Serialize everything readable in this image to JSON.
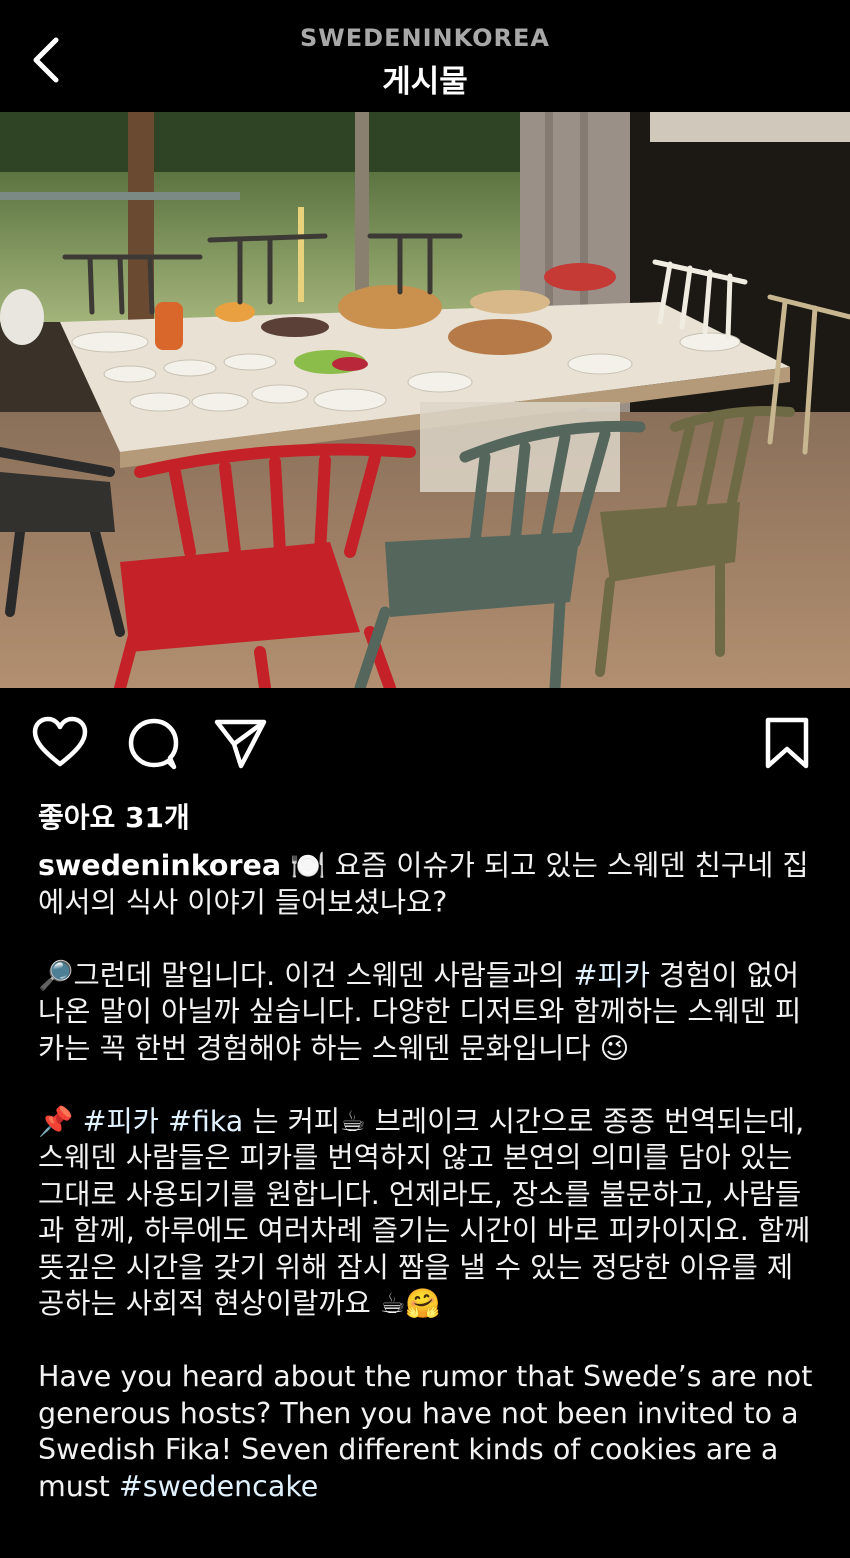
{
  "header": {
    "account": "SWEDENINKOREA",
    "title": "게시물"
  },
  "icons": {
    "back": "chevron-left-icon",
    "like": "heart-icon",
    "comment": "comment-bubble-icon",
    "share": "paper-plane-icon",
    "save": "bookmark-icon"
  },
  "post": {
    "likes_text": "좋아요 31개",
    "caption": {
      "username": "swedeninkorea",
      "p1_emoji": "🍽️",
      "p1_text": "요즘 이슈가 되고 있는 스웨덴 친구네 집에서의 식사 이야기 들어보셨나요?",
      "p2_emoji": "🔎",
      "p2_text_a": "그런데 말입니다. 이건 스웨덴 사람들과의 ",
      "p2_hashtag": "#피카",
      "p2_text_b": " 경험이 없어 나온 말이 아닐까 싶습니다. 다양한 디저트와 함께하는 스웨덴 피카는 꼭 한번 경험해야 하는 스웨덴 문화입니다 ",
      "p2_end_emoji": "😉",
      "p3_emoji": "📌",
      "p3_hashtag1": "#피카",
      "p3_hashtag2": "#fika",
      "p3_text_a": " 는 커피",
      "p3_coffee": "☕",
      "p3_text_b": " 브레이크 시간으로 종종 번역되는데, 스웨덴 사람들은 피카를 번역하지 않고 본연의 의미를 담아 있는 그대로 사용되기를 원합니다. 언제라도, 장소를 불문하고, 사람들과 함께, 하루에도 여러차례 즐기는 시간이 바로 피카이지요. 함께 뜻깊은 시간을 갖기 위해 잠시 짬을 낼 수 있는 정당한 이유를 제공하는 사회적 현상이랄까요 ",
      "p3_end_emoji1": "☕",
      "p3_end_emoji2": "🤗",
      "p4_text": "Have you heard about the rumor that Swede’s are not generous hosts? Then you have not been invited to a Swedish Fika! Seven different kinds of cookies are a must ",
      "p4_hashtag": "#swedencake"
    }
  },
  "colors": {
    "background": "#000000",
    "text": "#ffffff",
    "muted": "#a8a8a8",
    "hashtag": "#e0f1ff"
  }
}
